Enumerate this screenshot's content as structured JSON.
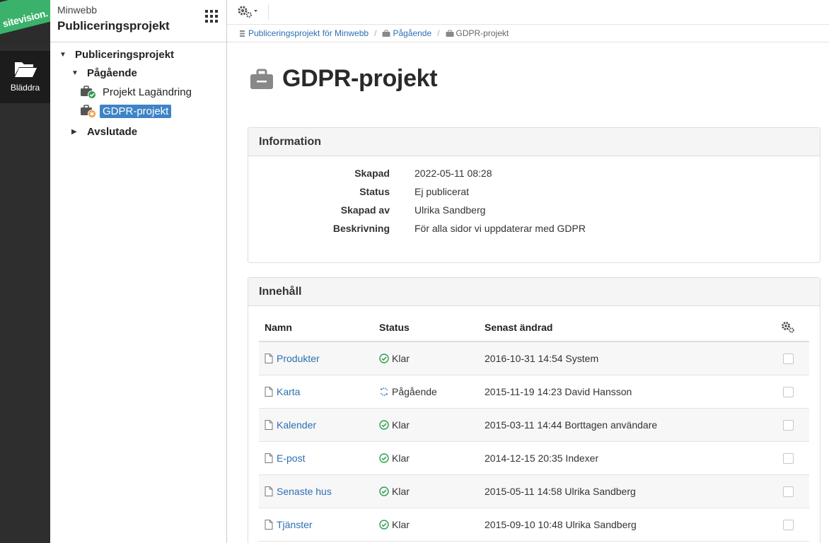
{
  "logo": {
    "text": "sitevision."
  },
  "rail": {
    "browse_label": "Bläddra"
  },
  "tree_header": {
    "site": "Minwebb",
    "section": "Publiceringsprojekt"
  },
  "tree": {
    "root": "Publiceringsprojekt",
    "ongoing": "Pågående",
    "project1": "Projekt Lagändring",
    "project2": "GDPR-projekt",
    "finished": "Avslutade"
  },
  "breadcrumb": {
    "items": [
      "Publiceringsprojekt för Minwebb",
      "Pågående",
      "GDPR-projekt"
    ],
    "separator": "/"
  },
  "page": {
    "title": "GDPR-projekt"
  },
  "info": {
    "heading": "Information",
    "rows": [
      {
        "key": "Skapad",
        "value": "2022-05-11 08:28"
      },
      {
        "key": "Status",
        "value": "Ej publicerat"
      },
      {
        "key": "Skapad av",
        "value": "Ulrika Sandberg"
      },
      {
        "key": "Beskrivning",
        "value": "För alla sidor vi uppdaterar med GDPR"
      }
    ]
  },
  "content": {
    "heading": "Innehåll",
    "columns": {
      "name": "Namn",
      "status": "Status",
      "modified": "Senast ändrad"
    },
    "rows": [
      {
        "name": "Produkter",
        "status": "Klar",
        "state": "done",
        "modified": "2016-10-31 14:54 System"
      },
      {
        "name": "Karta",
        "status": "Pågående",
        "state": "ongoing",
        "modified": "2015-11-19 14:23 David Hansson"
      },
      {
        "name": "Kalender",
        "status": "Klar",
        "state": "done",
        "modified": "2015-03-11 14:44 Borttagen användare"
      },
      {
        "name": "E-post",
        "status": "Klar",
        "state": "done",
        "modified": "2014-12-15 20:35 Indexer"
      },
      {
        "name": "Senaste hus",
        "status": "Klar",
        "state": "done",
        "modified": "2015-05-11 14:58 Ulrika Sandberg"
      },
      {
        "name": "Tjänster",
        "status": "Klar",
        "state": "done",
        "modified": "2015-09-10 10:48 Ulrika Sandberg"
      }
    ]
  },
  "colors": {
    "accent": "#3e83c6",
    "link": "#2d6fb3",
    "success": "#2e9e4f",
    "brand_green": "#3ab26b",
    "rail": "#2e2e2e"
  }
}
